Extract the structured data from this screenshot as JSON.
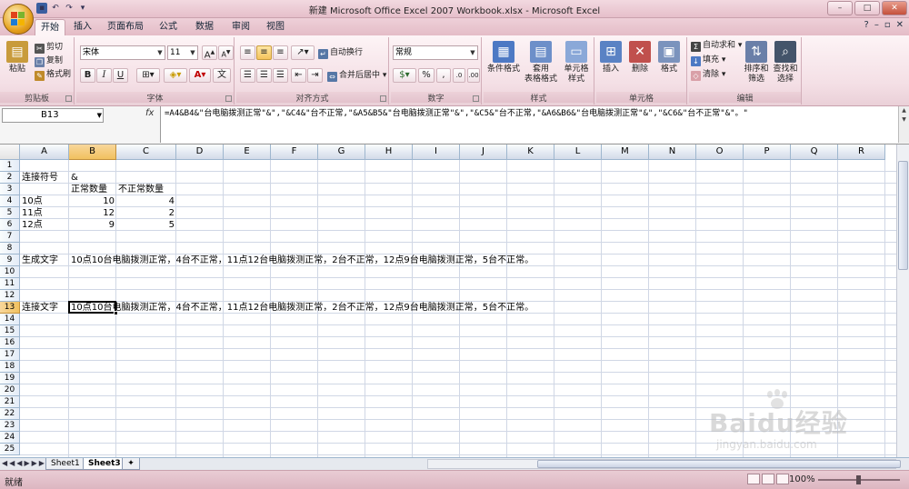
{
  "window": {
    "title": "新建 Microsoft Office Excel 2007 Workbook.xlsx - Microsoft Excel",
    "controls": [
      "minimize",
      "maximize",
      "close"
    ]
  },
  "ribbon_tabs": [
    "开始",
    "插入",
    "页面布局",
    "公式",
    "数据",
    "审阅",
    "视图"
  ],
  "active_tab": "开始",
  "ribbon": {
    "clipboard": {
      "label": "剪贴板",
      "paste": "粘贴",
      "cut": "剪切",
      "copy": "复制",
      "format_painter": "格式刷"
    },
    "font": {
      "label": "字体",
      "font_name": "宋体",
      "font_size": "11",
      "bold": "B",
      "italic": "I",
      "underline": "U"
    },
    "alignment": {
      "label": "对齐方式",
      "wrap_text": "自动换行",
      "merge_center": "合并后居中"
    },
    "number": {
      "label": "数字",
      "format": "常规",
      "percent": "%",
      "comma": ","
    },
    "styles": {
      "label": "样式",
      "conditional": "条件格式",
      "table_format": "套用\n表格格式",
      "cell_styles": "单元格\n样式"
    },
    "cells": {
      "label": "单元格",
      "insert": "插入",
      "delete": "删除",
      "format": "格式"
    },
    "editing": {
      "label": "编辑",
      "autosum": "自动求和",
      "fill": "填充",
      "clear": "清除",
      "sort_filter": "排序和\n筛选",
      "find_select": "查找和\n选择"
    }
  },
  "formula_bar": {
    "name_box": "B13",
    "fx": "fx",
    "formula": "=A4&B4&\"台电脑拨测正常\"&\",\"&C4&\"台不正常,\"&A5&B5&\"台电脑拨测正常\"&\",\"&C5&\"台不正常,\"&A6&B6&\"台电脑拨测正常\"&\",\"&C6&\"台不正常\"&\"。\""
  },
  "columns": [
    "A",
    "B",
    "C",
    "D",
    "E",
    "F",
    "G",
    "H",
    "I",
    "J",
    "K",
    "L",
    "M",
    "N",
    "O",
    "P",
    "Q",
    "R"
  ],
  "rows": [
    "1",
    "2",
    "3",
    "4",
    "5",
    "6",
    "7",
    "8",
    "9",
    "10",
    "11",
    "12",
    "13",
    "14",
    "15",
    "16",
    "17",
    "18",
    "19",
    "20",
    "21",
    "22",
    "23",
    "24",
    "25"
  ],
  "cells": {
    "A2": "连接符号",
    "B2": "&",
    "B3": "正常数量",
    "C3": "不正常数量",
    "A4": "10点",
    "B4": "10",
    "C4": "4",
    "A5": "11点",
    "B5": "12",
    "C5": "2",
    "A6": "12点",
    "B6": "9",
    "C6": "5",
    "A9": "生成文字",
    "B9": "10点10台电脑拨测正常，4台不正常，11点12台电脑拨测正常，2台不正常，12点9台电脑拨测正常，5台不正常。",
    "A13": "连接文字",
    "B13": "10点10台电脑拨测正常，4台不正常，11点12台电脑拨测正常，2台不正常，12点9台电脑拨测正常，5台不正常。"
  },
  "selected_cell": "B13",
  "sheets": [
    "Sheet1",
    "Sheet3"
  ],
  "active_sheet": "Sheet3",
  "status": {
    "mode": "就绪",
    "zoom": "100%"
  },
  "watermark": {
    "brand": "Baidu经验",
    "url": "jingyan.baidu.com"
  }
}
